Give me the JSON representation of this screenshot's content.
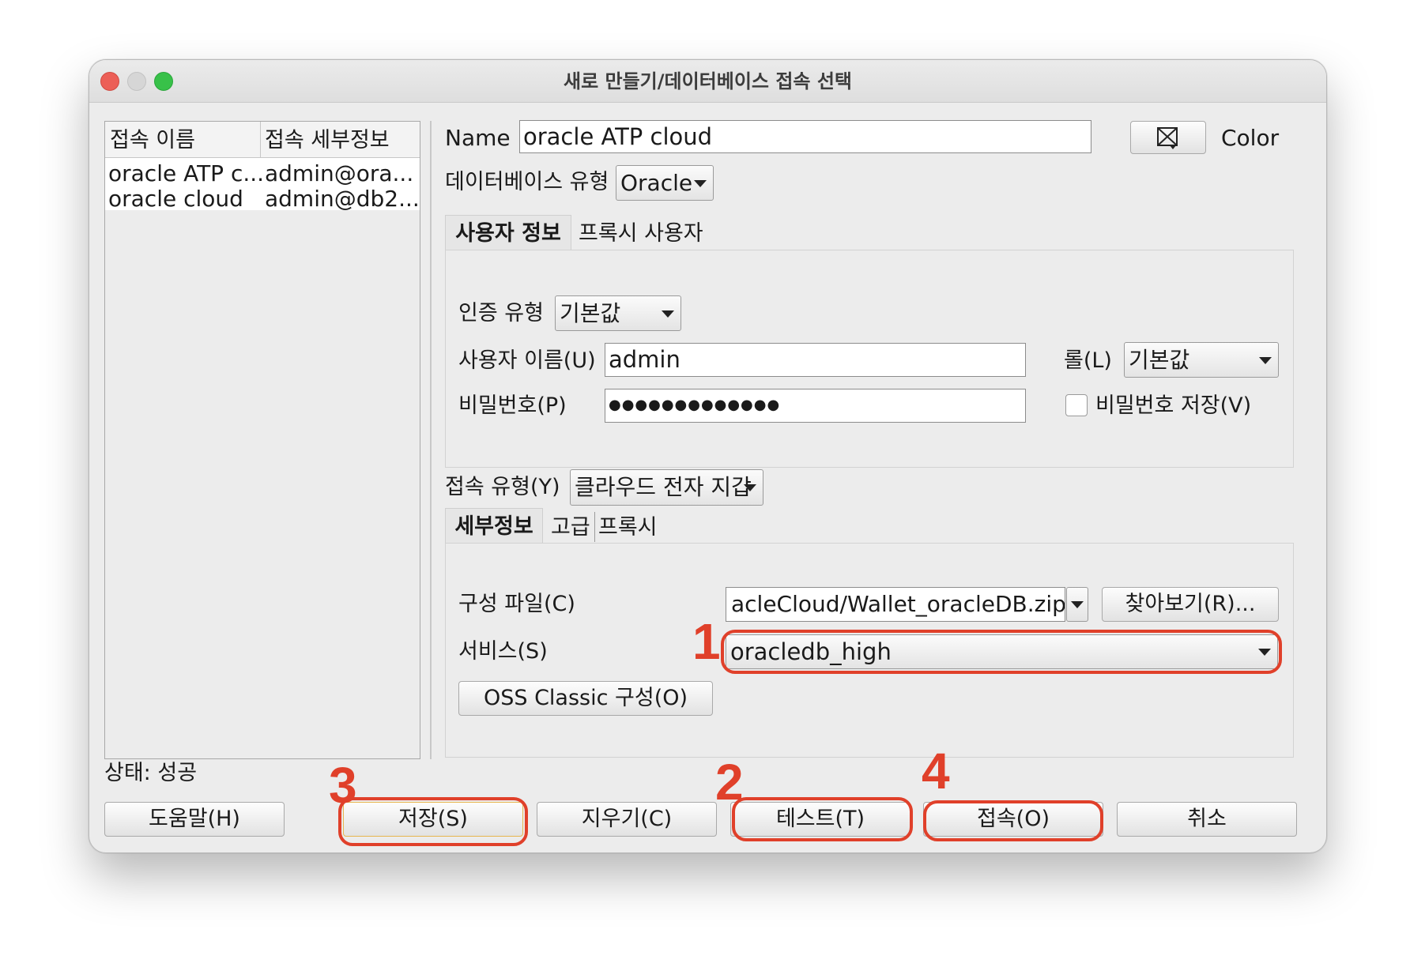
{
  "window": {
    "title": "새로 만들기/데이터베이스 접속 선택"
  },
  "connections": {
    "headers": [
      "접속 이름",
      "접속 세부정보"
    ],
    "rows": [
      {
        "name": "oracle ATP c...",
        "details": "admin@ora..."
      },
      {
        "name": "oracle cloud",
        "details": "admin@db2..."
      }
    ]
  },
  "status": "상태: 성공",
  "form": {
    "name_label": "Name",
    "name_value": "oracle ATP cloud",
    "color_label": "Color",
    "db_type_label": "데이터베이스 유형",
    "db_type_value": "Oracle",
    "user_tabs": [
      "사용자 정보",
      "프록시 사용자"
    ],
    "auth_type_label": "인증 유형",
    "auth_type_value": "기본값",
    "username_label": "사용자 이름(U)",
    "username_value": "admin",
    "role_label": "롤(L)",
    "role_value": "기본값",
    "password_label": "비밀번호(P)",
    "password_value": "●●●●●●●●●●●●●",
    "save_password_label": "비밀번호 저장(V)",
    "save_password_checked": false,
    "conn_type_label": "접속 유형(Y)",
    "conn_type_value": "클라우드 전자 지갑",
    "detail_tabs": [
      "세부정보",
      "고급",
      "프록시"
    ],
    "config_file_label": "구성 파일(C)",
    "config_file_value": "acleCloud/Wallet_oracleDB.zip",
    "browse_label": "찾아보기(R)...",
    "service_label": "서비스(S)",
    "service_value": "oracledb_high",
    "oss_button_label": "OSS Classic 구성(O)"
  },
  "buttons": {
    "help": "도움말(H)",
    "save": "저장(S)",
    "clear": "지우기(C)",
    "test": "테스트(T)",
    "connect": "접속(O)",
    "cancel": "취소"
  },
  "annotations": {
    "n1": "1",
    "n2": "2",
    "n3": "3",
    "n4": "4"
  },
  "colors": {
    "annotation_red": "#e0402a",
    "traffic_close": "#ec5f57",
    "traffic_zoom": "#38c149"
  }
}
